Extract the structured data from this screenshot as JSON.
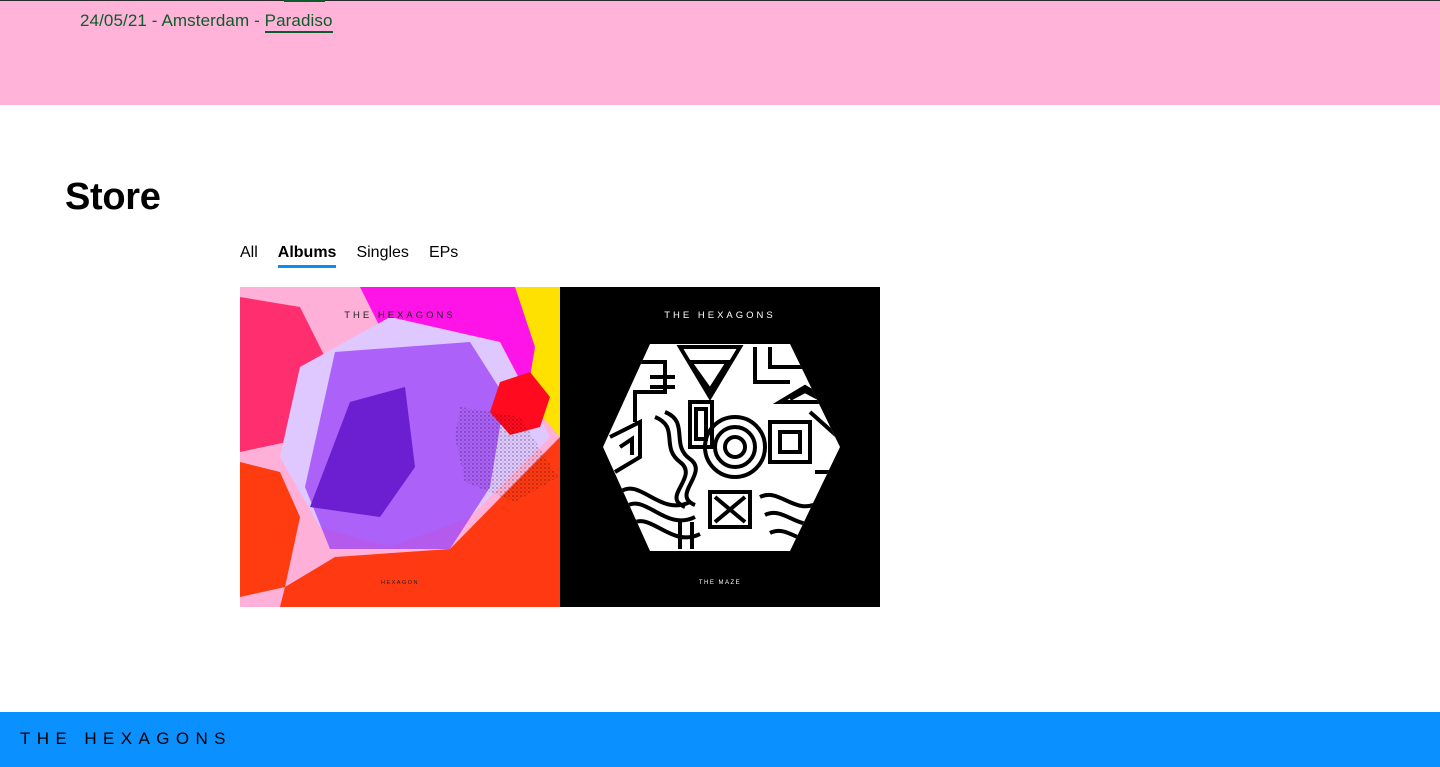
{
  "tour": {
    "date_location": "24/05/21 - Amsterdam - ",
    "venue": "Paradiso"
  },
  "store": {
    "title": "Store",
    "tabs": [
      {
        "label": "All"
      },
      {
        "label": "Albums",
        "active": true
      },
      {
        "label": "Singles"
      },
      {
        "label": "EPs"
      }
    ],
    "albums": [
      {
        "band": "THE HEXAGONS",
        "title": "HEXAGON"
      },
      {
        "band": "THE HEXAGONS",
        "title": "THE MAZE"
      }
    ]
  },
  "footer": {
    "logo": "THE HEXAGONS"
  },
  "colors": {
    "tour_bg": "#ffb3d9",
    "tour_text": "#0a5c2a",
    "accent": "#0a8df5",
    "footer_bg": "#0a91ff"
  }
}
